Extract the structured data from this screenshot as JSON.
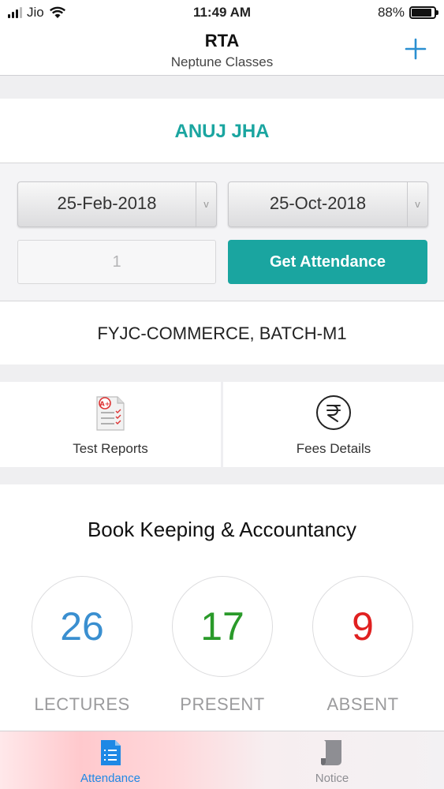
{
  "status_bar": {
    "carrier": "Jio",
    "time": "11:49 AM",
    "battery": "88%",
    "battery_level": 0.88
  },
  "header": {
    "title": "RTA",
    "subtitle": "Neptune Classes",
    "add_icon": "plus-icon"
  },
  "student": {
    "name": "ANUJ JHA"
  },
  "filters": {
    "from_date": "25-Feb-2018",
    "to_date": "25-Oct-2018",
    "count_value": "1",
    "get_button": "Get Attendance"
  },
  "batch": "FYJC-COMMERCE,  BATCH-M1",
  "actions": [
    {
      "label": "Test Reports",
      "icon": "test-report-icon"
    },
    {
      "label": "Fees Details",
      "icon": "rupee-icon"
    }
  ],
  "attendance": {
    "subject": "Book Keeping & Accountancy",
    "lectures": {
      "value": "26",
      "label": "LECTURES",
      "color": "#3a8fd0"
    },
    "present": {
      "value": "17",
      "label": "PRESENT",
      "color": "#2a9a2a"
    },
    "absent": {
      "value": "9",
      "label": "ABSENT",
      "color": "#e02020"
    }
  },
  "tabs": [
    {
      "label": "Attendance",
      "icon": "attendance-icon",
      "active": true,
      "color": "#1e88e5"
    },
    {
      "label": "Notice",
      "icon": "notice-icon",
      "active": false,
      "color": "#8e8e93"
    }
  ]
}
